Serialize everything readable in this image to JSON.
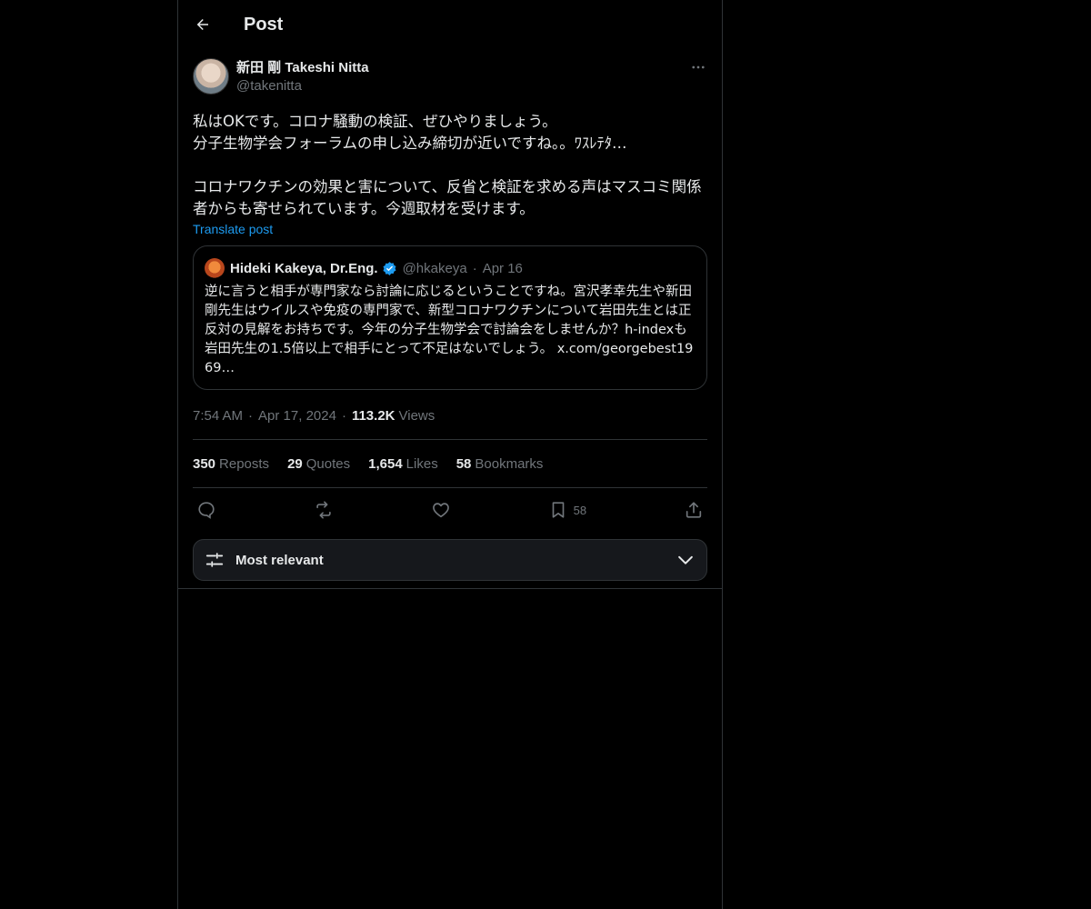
{
  "header": {
    "title": "Post"
  },
  "post": {
    "author_name": "新田 剛 Takeshi Nitta",
    "author_handle": "@takenitta",
    "text": "私はOKです。コロナ騒動の検証、ぜひやりましょう。\n分子生物学会フォーラムの申し込み締切が近いですね。。ﾜｽﾚﾃﾀ…\n\nコロナワクチンの効果と害について、反省と検証を求める声はマスコミ関係者からも寄せられています。今週取材を受けます。",
    "translate_label": "Translate post",
    "quote": {
      "name": "Hideki Kakeya, Dr.Eng.",
      "handle": "@hkakeya",
      "date": "Apr 16",
      "text": "逆に言うと相手が専門家なら討論に応じるということですね。宮沢孝幸先生や新田剛先生はウイルスや免疫の専門家で、新型コロナワクチンについて岩田先生とは正反対の見解をお持ちです。今年の分子生物学会で討論会をしませんか？h-indexも岩田先生の1.5倍以上で相手にとって不足はないでしょう。 x.com/georgebest1969…"
    },
    "time": "7:54 AM",
    "date": "Apr 17, 2024",
    "views_count": "113.2K",
    "views_label": "Views",
    "stats": {
      "reposts_count": "350",
      "reposts_label": "Reposts",
      "quotes_count": "29",
      "quotes_label": "Quotes",
      "likes_count": "1,654",
      "likes_label": "Likes",
      "bookmarks_count": "58",
      "bookmarks_label": "Bookmarks"
    },
    "actions": {
      "bookmark_count": "58"
    }
  },
  "sort": {
    "label": "Most relevant"
  },
  "icons": {
    "back": "arrow-left-icon",
    "more": "more-dots-icon",
    "verified": "verified-badge-icon",
    "reply": "reply-icon",
    "repost": "repost-icon",
    "like": "heart-icon",
    "bookmark": "bookmark-icon",
    "share": "share-icon",
    "sort": "sliders-icon",
    "chevron": "chevron-down-icon"
  },
  "colors": {
    "accent": "#1d9bf0",
    "background": "#000000",
    "border": "#2f3336",
    "muted": "#71767b"
  }
}
